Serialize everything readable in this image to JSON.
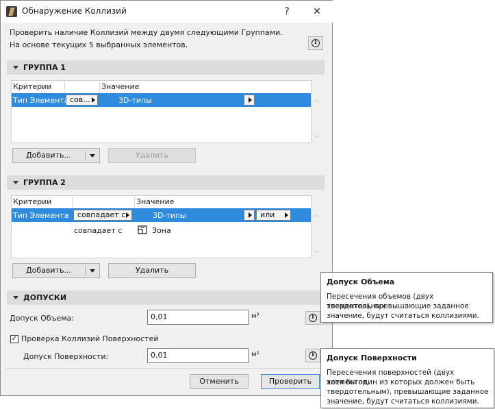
{
  "window": {
    "title": "Обнаружение Коллизий",
    "help_label": "?",
    "close_label": "✕"
  },
  "intro": {
    "line1": "Проверить наличие Коллизий между двумя следующими Группами.",
    "line2": "На основе текущих 5 выбранных элементов."
  },
  "group1": {
    "title": "ГРУППА 1",
    "col_criteria": "Критерии",
    "col_value": "Значение",
    "rows": [
      {
        "criteria": "Тип Элемента",
        "operator": "сов...",
        "value": "3D-типы"
      }
    ],
    "add_label": "Добавить...",
    "delete_label": "Удалить"
  },
  "group2": {
    "title": "ГРУППА 2",
    "col_criteria": "Критерии",
    "col_value": "Значение",
    "rows": [
      {
        "criteria": "Тип Элемента",
        "operator": "совпадает с",
        "value": "3D-типы",
        "logic": "или"
      },
      {
        "criteria": "",
        "operator": "совпадает с",
        "value": "Зона"
      }
    ],
    "add_label": "Добавить...",
    "delete_label": "Удалить"
  },
  "tolerances": {
    "title": "ДОПУСКИ",
    "volume_label": "Допуск Объема:",
    "volume_value": "0,01",
    "volume_unit": "м³",
    "surface_check_label": "Проверка Коллизий Поверхностей",
    "surface_check_checked": true,
    "surface_label": "Допуск Поверхности:",
    "surface_value": "0,01",
    "surface_unit": "м²"
  },
  "footer": {
    "cancel_label": "Отменить",
    "check_label": "Проверить"
  },
  "tooltips": {
    "volume": {
      "title": "Допуск Объема",
      "lines": [
        "Пересечения объемов (двух твердотельных",
        "элементов), превышающие заданное",
        "значение, будут считаться коллизиями."
      ]
    },
    "surface": {
      "title": "Допуск Поверхности",
      "lines": [
        "Пересечения поверхностей (двух элементов,",
        "хотя бы один из которых должен быть",
        "твердотельным), превышающие заданное",
        "значение, будут считаться коллизиями."
      ]
    }
  },
  "colors": {
    "selection": "#2f8bde",
    "dialog_bg": "#f0f0f0",
    "section_bg": "#dcdcdc"
  }
}
